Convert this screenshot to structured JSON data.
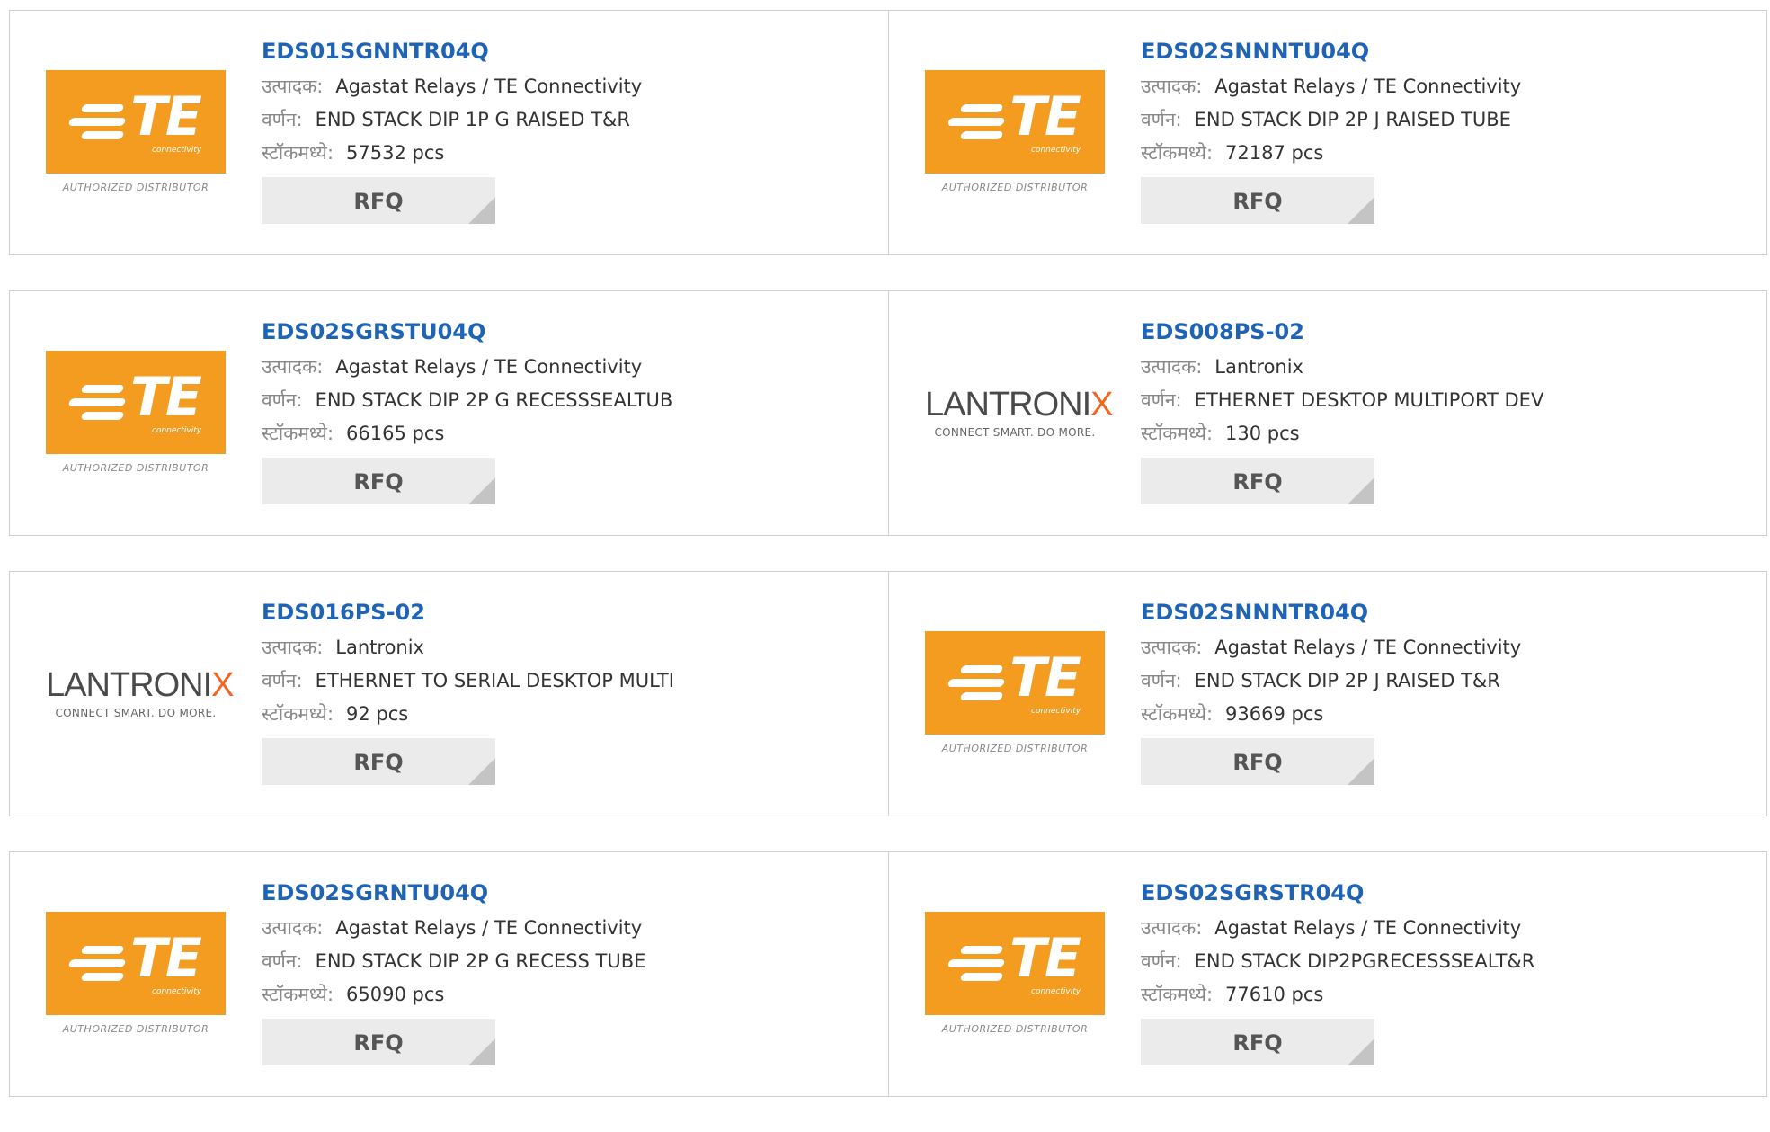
{
  "labels": {
    "manufacturer": "उत्पादक:",
    "description": "वर्णन:",
    "stock": "स्टॉकमध्ये:",
    "rfq": "RFQ"
  },
  "logos": {
    "te": {
      "name": "TE",
      "sub": "connectivity",
      "tagline": "AUTHORIZED DISTRIBUTOR",
      "color": "#f39c1f"
    },
    "lantronix": {
      "name": "LANTRONIX",
      "tagline": "CONNECT SMART. DO MORE.",
      "accent": "#f26522"
    }
  },
  "products": [
    {
      "part": "EDS01SGNNTR04Q",
      "logo": "te",
      "manufacturer": "Agastat Relays / TE Connectivity",
      "description": "END STACK DIP 1P G RAISED T&R",
      "stock": "57532 pcs"
    },
    {
      "part": "EDS02SNNNTU04Q",
      "logo": "te",
      "manufacturer": "Agastat Relays / TE Connectivity",
      "description": "END STACK DIP 2P J RAISED TUBE",
      "stock": "72187 pcs"
    },
    {
      "part": "EDS02SGRSTU04Q",
      "logo": "te",
      "manufacturer": "Agastat Relays / TE Connectivity",
      "description": "END STACK DIP 2P G RECESSSEALTUB",
      "stock": "66165 pcs"
    },
    {
      "part": "EDS008PS-02",
      "logo": "lantronix",
      "manufacturer": "Lantronix",
      "description": "ETHERNET DESKTOP MULTIPORT DEV",
      "stock": "130 pcs"
    },
    {
      "part": "EDS016PS-02",
      "logo": "lantronix",
      "manufacturer": "Lantronix",
      "description": "ETHERNET TO SERIAL DESKTOP MULTI",
      "stock": "92 pcs"
    },
    {
      "part": "EDS02SNNNTR04Q",
      "logo": "te",
      "manufacturer": "Agastat Relays / TE Connectivity",
      "description": "END STACK DIP 2P J RAISED T&R",
      "stock": "93669 pcs"
    },
    {
      "part": "EDS02SGRNTU04Q",
      "logo": "te",
      "manufacturer": "Agastat Relays / TE Connectivity",
      "description": "END STACK DIP 2P G RECESS TUBE",
      "stock": "65090 pcs"
    },
    {
      "part": "EDS02SGRSTR04Q",
      "logo": "te",
      "manufacturer": "Agastat Relays / TE Connectivity",
      "description": "END STACK DIP2PGRECESSSEALT&R",
      "stock": "77610 pcs"
    }
  ]
}
